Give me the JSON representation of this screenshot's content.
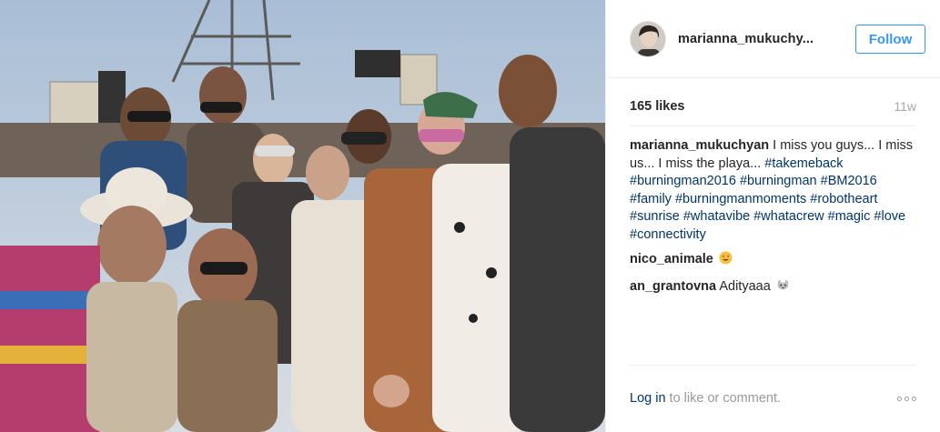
{
  "photo": {
    "alt_icon": "group-photo"
  },
  "header": {
    "username": "marianna_mukuchy...",
    "follow_label": "Follow"
  },
  "stats": {
    "likes": "165 likes",
    "age": "11w"
  },
  "caption": {
    "author": "marianna_mukuchyan",
    "text": "I miss you guys... I miss us... I miss the playa...",
    "hashtags": [
      "#takemeback",
      "#burningman2016",
      "#burningman",
      "#BM2016",
      "#family",
      "#burningmanmoments",
      "#robotheart",
      "#sunrise",
      "#whatavibe",
      "#whatacrew",
      "#magic",
      "#love",
      "#connectivity"
    ]
  },
  "comments": [
    {
      "author": "nico_animale",
      "text": "",
      "emoji": "heart-eyes-emoji"
    },
    {
      "author": "an_grantovna",
      "text": "Adityaaa",
      "emoji": "cat-emoji"
    }
  ],
  "footer": {
    "login_label": "Log in",
    "login_suffix": " to like or comment.",
    "more_icon": "more-options-icon"
  },
  "colors": {
    "accent": "#3897f0",
    "hashtag": "#003569",
    "muted": "#999999"
  }
}
